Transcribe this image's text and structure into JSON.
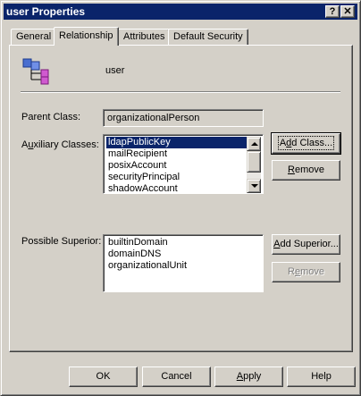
{
  "window": {
    "title": "user Properties",
    "help_label": "?",
    "close_label": "✕"
  },
  "tabs": [
    {
      "label": "General",
      "active": false
    },
    {
      "label": "Relationship",
      "active": true
    },
    {
      "label": "Attributes",
      "active": false
    },
    {
      "label": "Default Security",
      "active": false
    }
  ],
  "object": {
    "name": "user",
    "icon": "class-schema-icon"
  },
  "parent_class": {
    "label": "Parent Class:",
    "value": "organizationalPerson"
  },
  "auxiliary": {
    "label_pre": "A",
    "label_mn": "u",
    "label_post": "xiliary Classes:",
    "items": [
      "ldapPublicKey",
      "mailRecipient",
      "posixAccount",
      "securityPrincipal",
      "shadowAccount"
    ],
    "selected_index": 0,
    "add_pre": "A",
    "add_mn": "d",
    "add_post": "d Class...",
    "remove_pre": "",
    "remove_mn": "R",
    "remove_post": "emove"
  },
  "superior": {
    "label": "Possible Superior:",
    "items": [
      "builtinDomain",
      "domainDNS",
      "organizationalUnit"
    ],
    "add_pre": "",
    "add_mn": "A",
    "add_post": "dd Superior...",
    "remove_pre": "R",
    "remove_mn": "e",
    "remove_post": "move"
  },
  "footer": {
    "ok": "OK",
    "cancel": "Cancel",
    "apply_mn": "A",
    "apply_post": "pply",
    "help": "Help"
  },
  "colors": {
    "titlebar": "#0a246a",
    "face": "#d4d0c8",
    "selection": "#0a246a"
  }
}
